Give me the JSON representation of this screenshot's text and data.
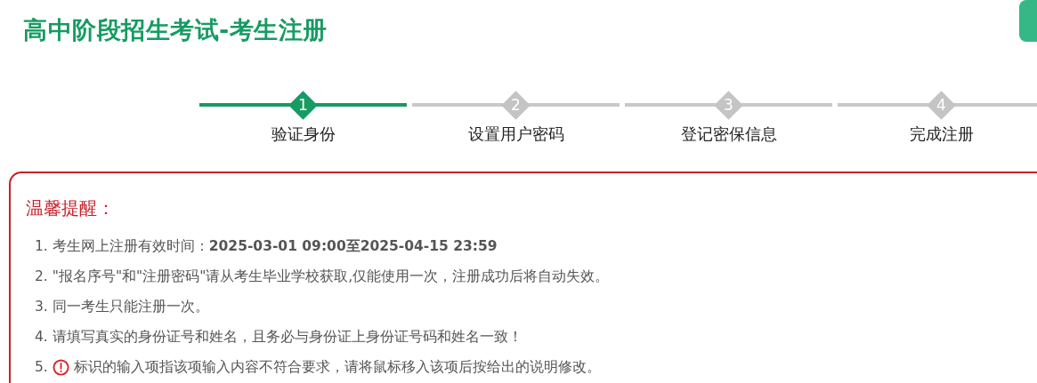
{
  "header": {
    "title": "高中阶段招生考试-考生注册"
  },
  "steps": [
    {
      "number": "1",
      "label": "验证身份",
      "selected": true
    },
    {
      "number": "2",
      "label": "设置用户密码",
      "selected": false
    },
    {
      "number": "3",
      "label": "登记密保信息",
      "selected": false
    },
    {
      "number": "4",
      "label": "完成注册",
      "selected": false
    }
  ],
  "notice": {
    "heading": "温馨提醒：",
    "items": [
      {
        "kind": "text",
        "number": "1.",
        "text": "考生网上注册有效时间：**2025-03-01 09:00至2025-04-15 23:59**"
      },
      {
        "kind": "text",
        "number": "2.",
        "text": "\"报名序号\"和\"注册密码\"请从考生毕业学校获取,仅能使用一次，注册成功后将自动失效。"
      },
      {
        "kind": "text",
        "number": "3.",
        "text": "同一考生只能注册一次。"
      },
      {
        "kind": "text",
        "number": "4.",
        "text": "请填写真实的身份证号和姓名，且务必与身份证上身份证号码和姓名一致！"
      },
      {
        "kind": "icon_text",
        "number": "5.",
        "text": "标识的输入项指该项输入内容不符合要求，请将鼠标移入该项后按给出的说明修改。"
      }
    ]
  }
}
